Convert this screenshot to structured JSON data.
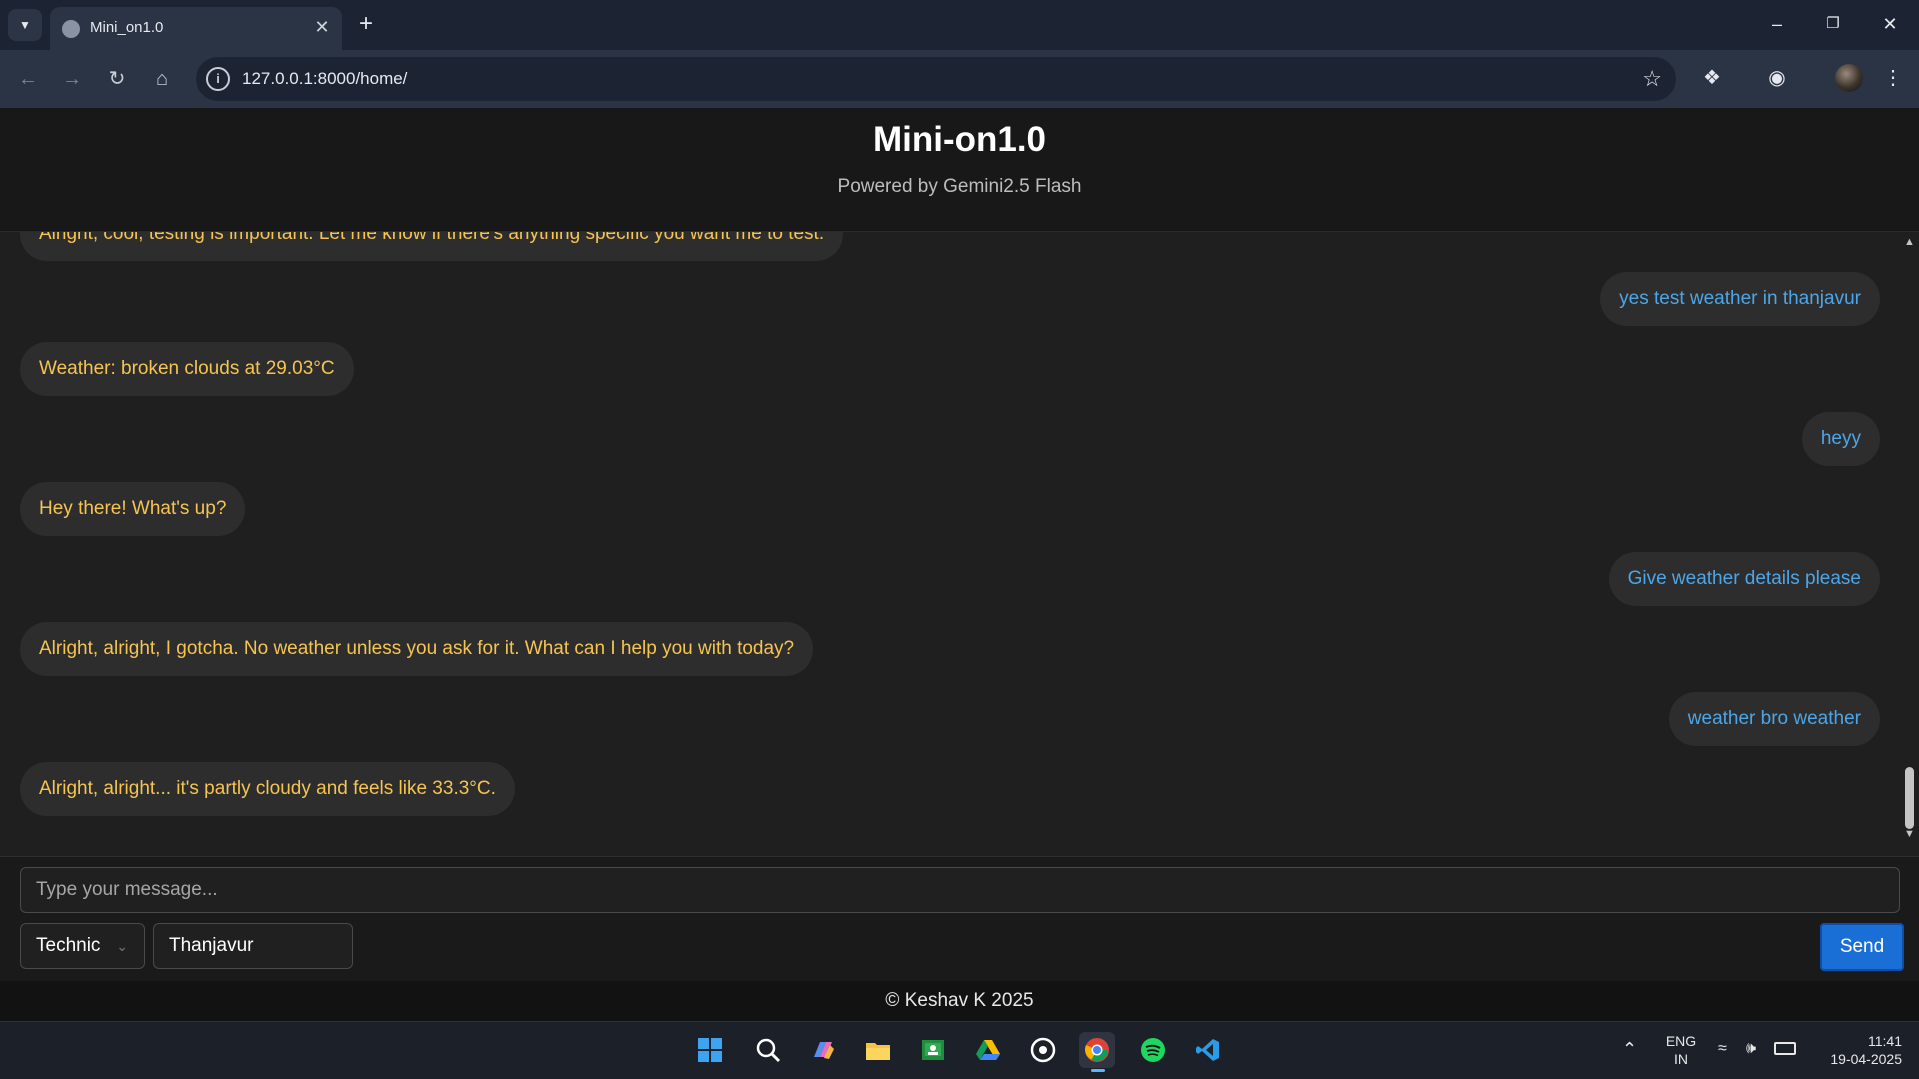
{
  "browser": {
    "tab_title": "Mini_on1.0",
    "url": "127.0.0.1:8000/home/"
  },
  "app": {
    "title": "Mini-on1.0",
    "subtitle": "Powered by Gemini2.5 Flash"
  },
  "messages": [
    {
      "role": "bot",
      "text": "Alright, cool, testing is important. Let me know if there's anything specific you want me to test."
    },
    {
      "role": "user",
      "text": "yes test weather in thanjavur"
    },
    {
      "role": "bot",
      "text": "Weather: broken clouds at 29.03°C"
    },
    {
      "role": "user",
      "text": "heyy"
    },
    {
      "role": "bot",
      "text": "Hey there! What's up?"
    },
    {
      "role": "user",
      "text": "Give weather details please"
    },
    {
      "role": "bot",
      "text": "Alright, alright, I gotcha. No weather unless you ask for it. What can I help you with today?"
    },
    {
      "role": "user",
      "text": "weather bro weather"
    },
    {
      "role": "bot",
      "text": "Alright, alright... it's partly cloudy and feels like 33.3°C."
    }
  ],
  "composer": {
    "placeholder": "Type your message...",
    "mode_value": "Technic",
    "city_value": "Thanjavur",
    "send_label": "Send"
  },
  "footer": {
    "text": "© Keshav K 2025"
  },
  "taskbar": {
    "lang_top": "ENG",
    "lang_bottom": "IN",
    "time": "11:41",
    "date": "19-04-2025"
  },
  "colors": {
    "bot_text": "#f5c451",
    "user_text": "#4da6e8",
    "send_button": "#1a6fd6"
  }
}
